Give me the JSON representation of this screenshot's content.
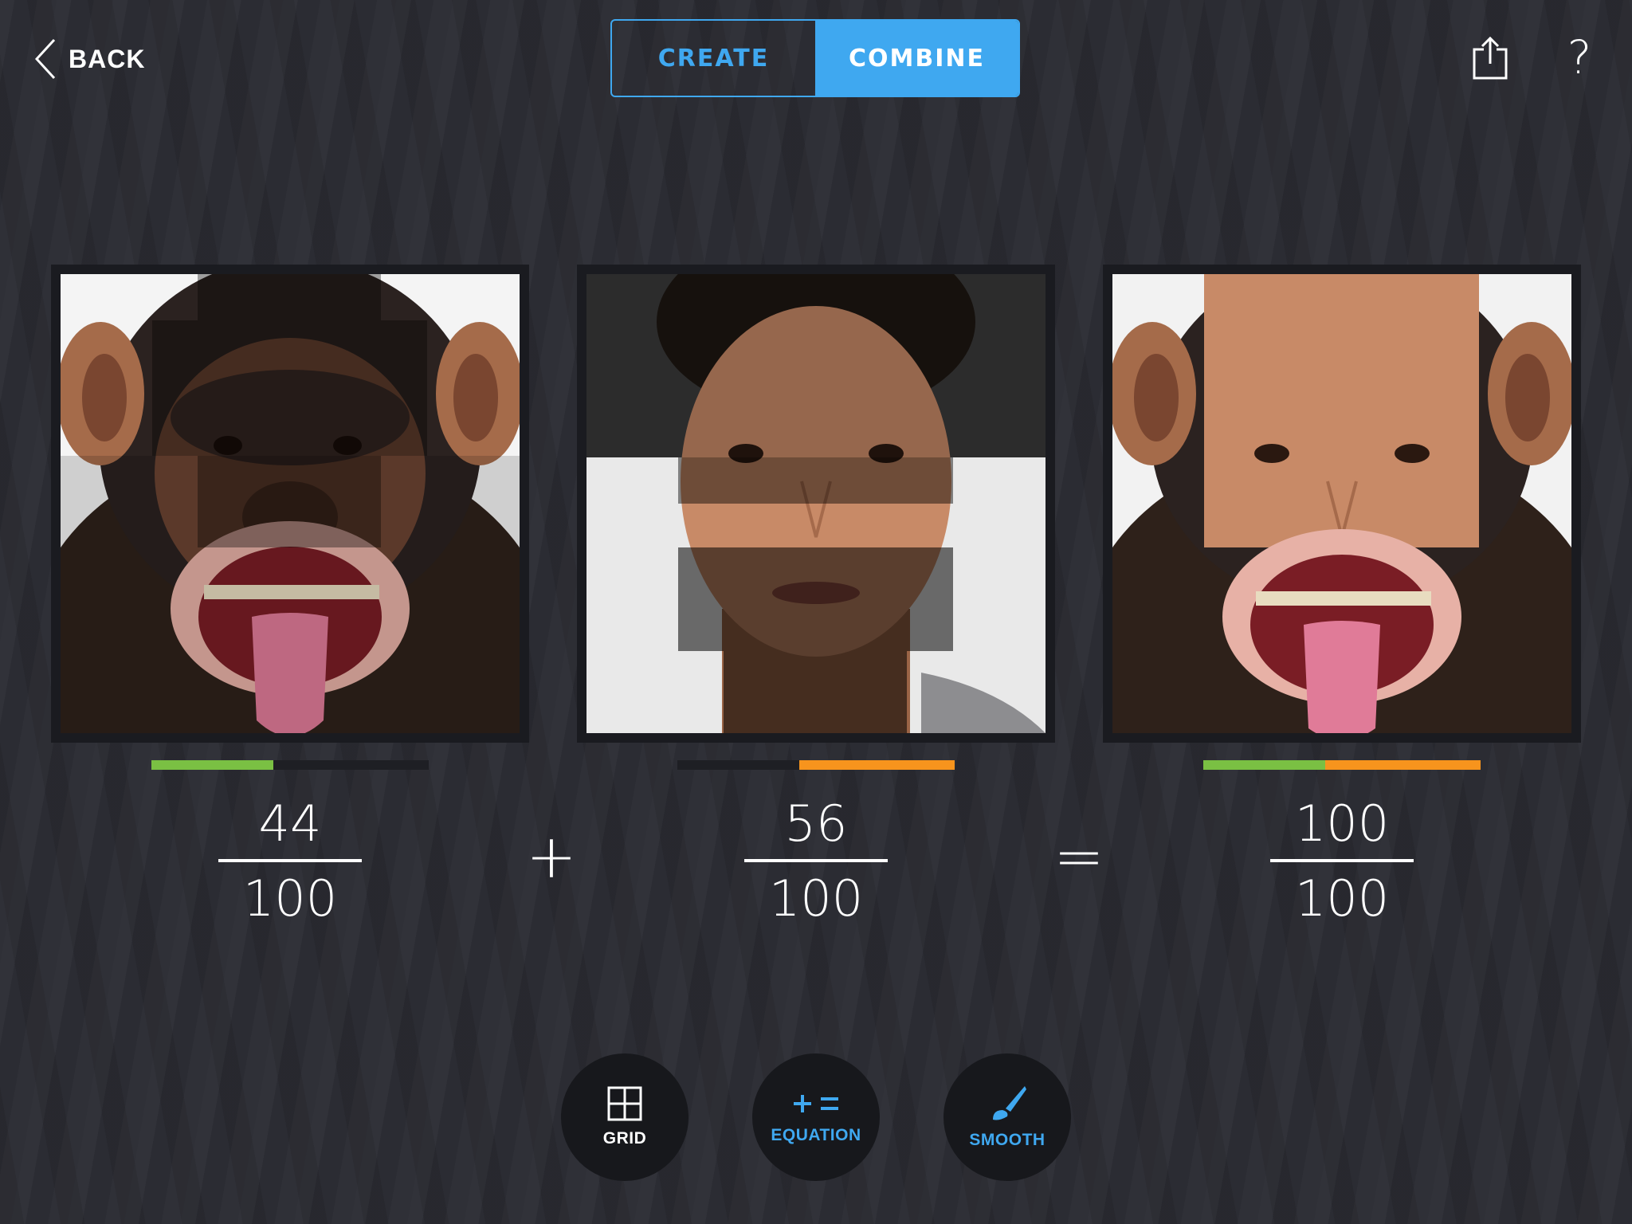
{
  "header": {
    "back_label": "BACK",
    "tabs": [
      {
        "label": "CREATE",
        "active": false
      },
      {
        "label": "COMBINE",
        "active": true
      }
    ],
    "share_icon": "share-icon",
    "help_label": "?"
  },
  "colors": {
    "accent": "#3fa8f0",
    "green": "#7ac043",
    "orange": "#f7941d",
    "background": "#2b2c33"
  },
  "panels": [
    {
      "subject": "chimpanzee",
      "progress_green": 0.44,
      "progress_orange": 0.0,
      "numerator": "44",
      "denominator": "100"
    },
    {
      "subject": "woman",
      "progress_green": 0.0,
      "progress_orange": 0.56,
      "numerator": "56",
      "denominator": "100"
    },
    {
      "subject": "combined",
      "progress_green": 0.44,
      "progress_orange": 0.56,
      "numerator": "100",
      "denominator": "100"
    }
  ],
  "operators": {
    "plus": "+",
    "equals": "="
  },
  "tools": [
    {
      "label": "GRID",
      "icon": "grid-icon"
    },
    {
      "label": "EQUATION",
      "icon": "equation-icon"
    },
    {
      "label": "SMOOTH",
      "icon": "brush-icon"
    }
  ]
}
